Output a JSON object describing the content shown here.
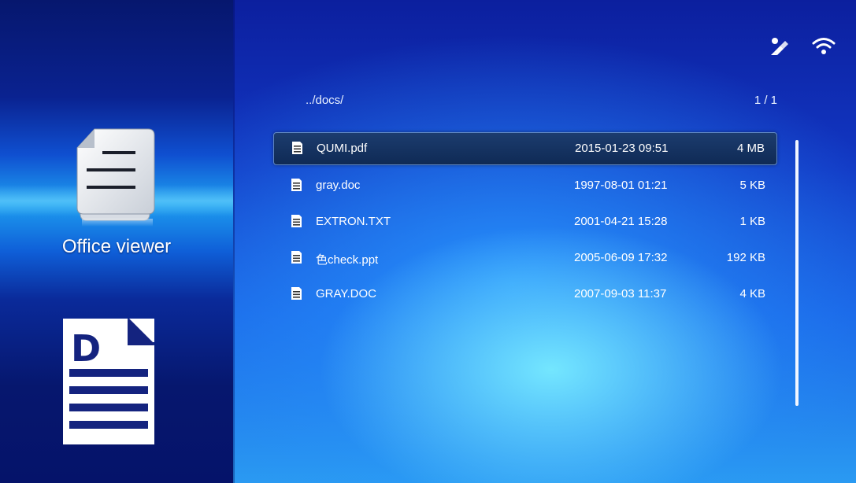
{
  "app": {
    "name": "Office viewer"
  },
  "browser": {
    "path": "../docs/",
    "page_indicator": "1 / 1"
  },
  "status_icons": [
    "usb-edit-icon",
    "wifi-icon"
  ],
  "files": [
    {
      "name": "QUMI.pdf",
      "date": "2015-01-23 09:51",
      "size": "4 MB",
      "selected": true
    },
    {
      "name": "gray.doc",
      "date": "1997-08-01 01:21",
      "size": "5 KB",
      "selected": false
    },
    {
      "name": "EXTRON.TXT",
      "date": "2001-04-21 15:28",
      "size": "1 KB",
      "selected": false
    },
    {
      "name": "色check.ppt",
      "date": "2005-06-09 17:32",
      "size": "192 KB",
      "selected": false
    },
    {
      "name": "GRAY.DOC",
      "date": "2007-09-03 11:37",
      "size": "4 KB",
      "selected": false
    }
  ],
  "doc_type_letter": "D",
  "colors": {
    "accent_dark": "#0a1f7a",
    "selection": "#1c3c6e",
    "doc_icon_blue": "#14237f"
  }
}
